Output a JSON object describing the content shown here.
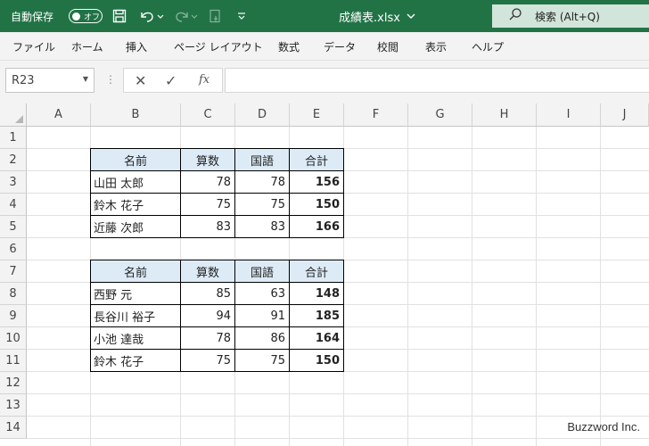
{
  "titlebar": {
    "autosave_label": "自動保存",
    "autosave_state": "オフ",
    "doc_title": "成績表.xlsx",
    "search_label": "検索 (Alt+Q)"
  },
  "ribbon": {
    "tabs": [
      "ファイル",
      "ホーム",
      "挿入",
      "ページ レイアウト",
      "数式",
      "データ",
      "校閲",
      "表示",
      "ヘルプ"
    ]
  },
  "formula_bar": {
    "name_box": "R23",
    "formula": ""
  },
  "columns": [
    "A",
    "B",
    "C",
    "D",
    "E",
    "F",
    "G",
    "H",
    "I",
    "J"
  ],
  "rows": [
    "1",
    "2",
    "3",
    "4",
    "5",
    "6",
    "7",
    "8",
    "9",
    "10",
    "11",
    "12",
    "13",
    "14"
  ],
  "table1": {
    "headers": [
      "名前",
      "算数",
      "国語",
      "合計"
    ],
    "rows": [
      [
        "山田 太郎",
        "78",
        "78",
        "156"
      ],
      [
        "鈴木 花子",
        "75",
        "75",
        "150"
      ],
      [
        "近藤 次郎",
        "83",
        "83",
        "166"
      ]
    ]
  },
  "table2": {
    "headers": [
      "名前",
      "算数",
      "国語",
      "合計"
    ],
    "rows": [
      [
        "西野 元",
        "85",
        "63",
        "148"
      ],
      [
        "長谷川 裕子",
        "94",
        "91",
        "185"
      ],
      [
        "小池 達哉",
        "78",
        "86",
        "164"
      ],
      [
        "鈴木 花子",
        "75",
        "75",
        "150"
      ]
    ]
  },
  "watermark": "Buzzword Inc.",
  "colors": {
    "accent": "#217346",
    "table_header_fill": "#ddebf7"
  }
}
